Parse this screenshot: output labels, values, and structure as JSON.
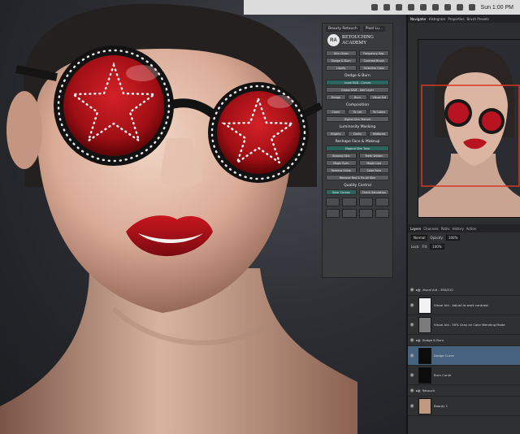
{
  "menubar": {
    "icons": [
      "app-icon",
      "app-icon",
      "app-icon",
      "app-icon",
      "app-icon",
      "app-icon",
      "wifi-icon",
      "volume-icon",
      "flag-icon"
    ],
    "time": "Sun 1:00 PM"
  },
  "retouch_panel": {
    "tabs": [
      "Beauty Retouch",
      "Pixel Lu..."
    ],
    "logo_badge": "RA",
    "logo_line1": "RETOUCHING",
    "logo_line2": "ACADEMY",
    "top_buttons": [
      "Skin Clean",
      "Frequency Sep.",
      "Dodge & Burn",
      "Contrast Brush",
      "Liquify",
      "Selective Color"
    ],
    "section_dodge": "Dodge & Burn",
    "dodge_rows": [
      "Local D&B - Curves",
      "Global D&B - Add Layer"
    ],
    "dodge_small": [
      "Dodge",
      "Burn",
      "Visual Aid"
    ],
    "section_composition": "Composition",
    "comp_small": [
      "Clone",
      "To Lab",
      "To Colors"
    ],
    "comp_wide": "Digital Skin Texture",
    "section_luminosity": "Luminosity Masking",
    "lum_small": [
      "Brights",
      "Darks",
      "Midtones"
    ],
    "section_reshape": "Reshape Face & Makeup",
    "reshape_wide": "Magical Skin Tone",
    "reshape_buttons": [
      "Glowing Skin",
      "Teeth Whiten",
      "Magic Eyes",
      "Magic Lips",
      "Remove Shine",
      "Color Face"
    ],
    "reshape_bottom": "Remove Red & Fix All Skin",
    "section_quality": "Quality Control",
    "quality_buttons": [
      "Solar Curves",
      "Check Saturation"
    ]
  },
  "navigator": {
    "tabs": [
      "Navigator",
      "Histogram",
      "Properties",
      "Brush Presets"
    ]
  },
  "layers": {
    "tabs": [
      "Layers",
      "Channels",
      "Paths",
      "History",
      "Action"
    ],
    "blend_mode": "Normal",
    "opacity_label": "Opacity:",
    "opacity": "100%",
    "fill_label": "Fill:",
    "fill": "100%",
    "lock_label": "Lock:",
    "rows": [
      {
        "name": "Visual Aid - 390/510",
        "type": "group"
      },
      {
        "name": "Visual Aid - Adjust to work contrast",
        "type": "layer",
        "thumb": "#f2f2f2"
      },
      {
        "name": "Visual Aid - 50% Gray on Color Blending Mode",
        "type": "layer",
        "thumb": "#7a7a7a"
      },
      {
        "name": "Dodge & Burn",
        "type": "group"
      },
      {
        "name": "Dodge Curve",
        "type": "layer",
        "thumb": "#0c0c0c",
        "selected": true
      },
      {
        "name": "Burn Curve",
        "type": "layer",
        "thumb": "#0c0c0c"
      },
      {
        "name": "Retouch",
        "type": "group"
      },
      {
        "name": "Beauty 1",
        "type": "layer",
        "thumb": "#c09a80"
      }
    ]
  },
  "colors": {
    "accent_teal": "#2c6460",
    "selection_blue": "#46627e",
    "lips_red": "#b81320"
  }
}
